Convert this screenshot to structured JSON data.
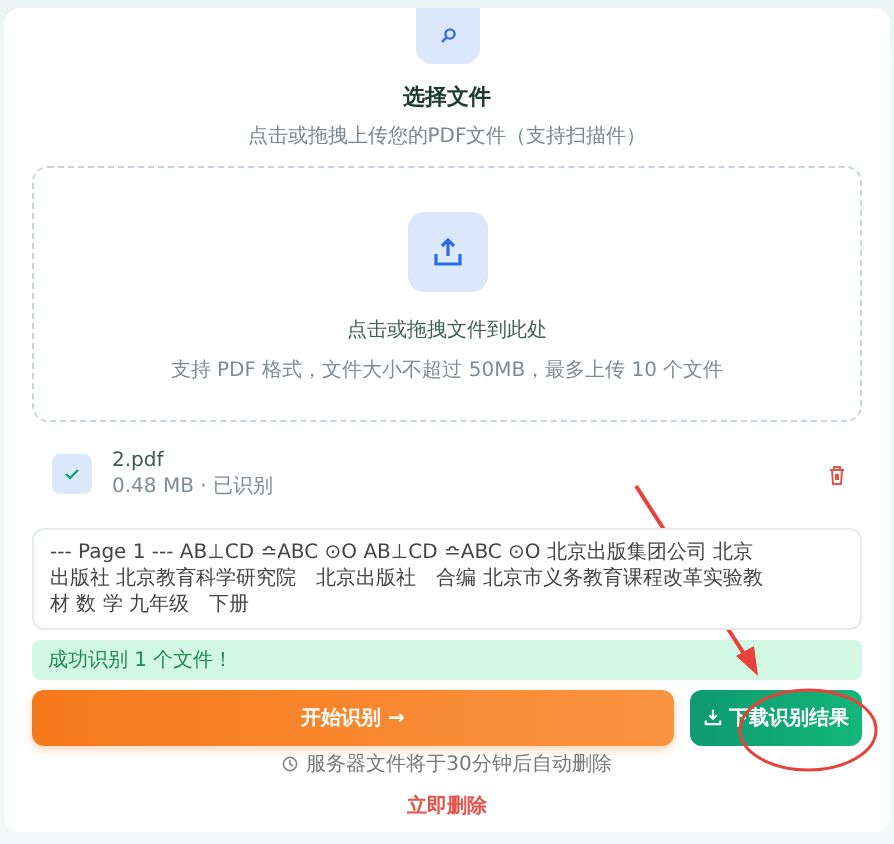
{
  "header": {
    "title": "选择文件",
    "subtitle": "点击或拖拽上传您的PDF文件（支持扫描件）"
  },
  "dropzone": {
    "title": "点击或拖拽文件到此处",
    "hint": "支持 PDF 格式，文件大小不超过 50MB，最多上传 10 个文件"
  },
  "files": [
    {
      "name": "2.pdf",
      "meta": "0.48 MB · 已识别",
      "recognized": true
    }
  ],
  "extracted_text": "--- Page 1 --- AB⊥CD ≏ABC ⊙O AB⊥CD ≏ABC ⊙O 北京出版集团公司 北京出版社 北京教育科学研究院　北京出版社　合编 北京市义务教育课程改革实验教材 数 学 九年级　下册",
  "status": {
    "message": "成功识别 1 个文件！"
  },
  "buttons": [
    {
      "kind": "primary",
      "label": "开始识别 →"
    },
    {
      "kind": "download",
      "label": "下载识别结果"
    }
  ],
  "note": "服务器文件将于30分钟后自动删除",
  "delete_link": "立即删除"
}
